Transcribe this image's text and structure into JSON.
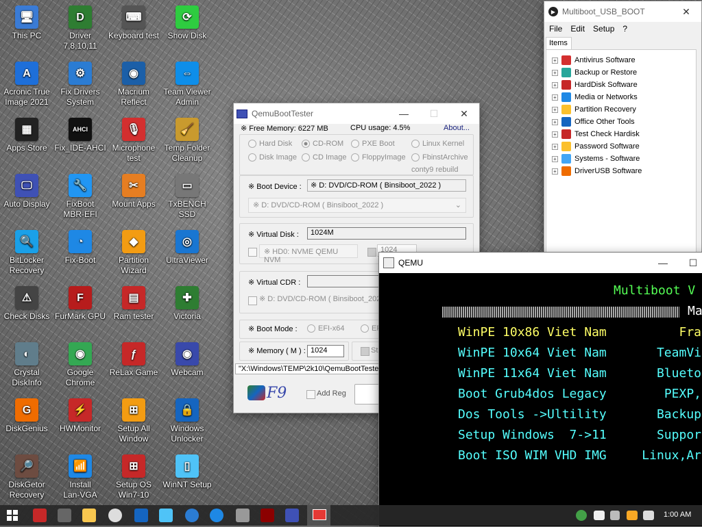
{
  "desktop": {
    "icons": [
      {
        "label": "This PC",
        "glyph": "🖥",
        "color": "#3a7bd5"
      },
      {
        "label": "Driver\n7,8,10,11",
        "glyph": "D",
        "color": "#2e7d32"
      },
      {
        "label": "Keyboard test",
        "glyph": "⌨",
        "color": "#555555"
      },
      {
        "label": "Show Disk",
        "glyph": "⟳",
        "color": "#2ecc40"
      },
      {
        "label": "Acronic True\nImage 2021",
        "glyph": "A",
        "color": "#1e6fd9"
      },
      {
        "label": "Fix Drivers\nSystem",
        "glyph": "⚙",
        "color": "#2b7cd3"
      },
      {
        "label": "Macrium\nReflect",
        "glyph": "◉",
        "color": "#1b5fa8"
      },
      {
        "label": "Team Viewer\nAdmin",
        "glyph": "⇔",
        "color": "#0e8ee9"
      },
      {
        "label": "Apps Store",
        "glyph": "▦",
        "color": "#222222"
      },
      {
        "label": "Fix_IDE-AHCI",
        "glyph": "AHCI",
        "color": "#111111"
      },
      {
        "label": "Microphone\ntest",
        "glyph": "🎙",
        "color": "#d32f2f"
      },
      {
        "label": "Temp Folder\nCleanup",
        "glyph": "🧹",
        "color": "#c99a2e"
      },
      {
        "label": "Auto Display",
        "glyph": "🖵",
        "color": "#3f51b5"
      },
      {
        "label": "FixBoot\nMBR-EFI",
        "glyph": "🔧",
        "color": "#2196f3"
      },
      {
        "label": "Mount Apps",
        "glyph": "✂",
        "color": "#e67e22"
      },
      {
        "label": "TxBENCH SSD",
        "glyph": "▭",
        "color": "#777777"
      },
      {
        "label": "BitLocker\nRecovery",
        "glyph": "🔍",
        "color": "#1aa0e8"
      },
      {
        "label": "Fix-Boot",
        "glyph": "◔",
        "color": "#1e88e5"
      },
      {
        "label": "Partition\nWizard",
        "glyph": "◆",
        "color": "#f39c12"
      },
      {
        "label": "UltraViewer",
        "glyph": "◎",
        "color": "#1976d2"
      },
      {
        "label": "Check Disks",
        "glyph": "⚠",
        "color": "#444444"
      },
      {
        "label": "FurMark GPU",
        "glyph": "F",
        "color": "#b71c1c"
      },
      {
        "label": "Ram tester",
        "glyph": "▤",
        "color": "#c62828"
      },
      {
        "label": "Victoria",
        "glyph": "✚",
        "color": "#2e7d32"
      },
      {
        "label": "Crystal\nDiskInfo",
        "glyph": "◐",
        "color": "#607d8b"
      },
      {
        "label": "Google\nChrome",
        "glyph": "◉",
        "color": "#34a853"
      },
      {
        "label": "ReLax Game",
        "glyph": "ƒ",
        "color": "#c62828"
      },
      {
        "label": "Webcam",
        "glyph": "◉",
        "color": "#3949ab"
      },
      {
        "label": "DiskGenius",
        "glyph": "G",
        "color": "#ef6c00"
      },
      {
        "label": "HWMonitor",
        "glyph": "⚡",
        "color": "#c62828"
      },
      {
        "label": "Setup All\nWindow",
        "glyph": "⊞",
        "color": "#f39c12"
      },
      {
        "label": "Windows\nUnlocker",
        "glyph": "🔒",
        "color": "#1565c0"
      },
      {
        "label": "DiskGetor\nRecovery",
        "glyph": "🔎",
        "color": "#6d4c41"
      },
      {
        "label": "Install\nLan-VGA",
        "glyph": "📶",
        "color": "#1e88e5"
      },
      {
        "label": "Setup OS\nWin7-10",
        "glyph": "⊞",
        "color": "#c62828"
      },
      {
        "label": "WinNT Setup",
        "glyph": "▯",
        "color": "#4fc3f7"
      }
    ]
  },
  "qemu_boot_tester": {
    "title": "QemuBootTester",
    "free_memory": "※ Free Memory: 6227 MB",
    "cpu_usage": "CPU usage: 4.5%",
    "about": "About...",
    "radios": [
      "Hard Disk",
      "CD-ROM",
      "PXE Boot",
      "Linux Kernel",
      "Disk Image",
      "CD Image",
      "FloppyImage",
      "FbinstArchive"
    ],
    "credit": "conty9 rebuild",
    "boot_device_label": "※ Boot Device :",
    "boot_device_value": "※ D: DVD/CD-ROM  ( Binsiboot_2022 )",
    "boot_device_combo": "※ D: DVD/CD-ROM  ( Binsiboot_2022 )",
    "virtual_disk_label": "※ Virtual Disk :",
    "virtual_disk_value": "1024M",
    "hd0_combo": "※ HD0: NVME QEMU NVM",
    "hd_extra_value": "1024",
    "virtual_cdr_label": "※ Virtual CDR :",
    "virtual_cdr_value": "",
    "cdr_combo": "※ D: DVD/CD-ROM  ( Binsiboot_202",
    "boot_mode_label": "※ Boot Mode :",
    "boot_mode_options": [
      "EFI-x64",
      "EF"
    ],
    "memory_label": "※ Memory ( M ) :",
    "memory_value": "1024",
    "memory_extra": "St",
    "path": "\"X:\\Windows\\TEMP\\2k10\\QemuBootTester",
    "f9_label": "F9",
    "add_reg_label": "Add Reg"
  },
  "multiboot": {
    "title": "Multiboot_USB_BOOT",
    "menu": [
      "File",
      "Edit",
      "Setup",
      "?"
    ],
    "tab": "Items",
    "items": [
      {
        "label": "Antivirus Software",
        "color": "#d32f2f"
      },
      {
        "label": "Backup or Restore",
        "color": "#26a69a"
      },
      {
        "label": "HardDisk Software",
        "color": "#c62828"
      },
      {
        "label": "Media or Networks",
        "color": "#1e88e5"
      },
      {
        "label": "Partition Recovery",
        "color": "#fbc02d"
      },
      {
        "label": "Office Other Tools",
        "color": "#1565c0"
      },
      {
        "label": "Test Check Hardisk",
        "color": "#c62828"
      },
      {
        "label": "Password Software",
        "color": "#fbc02d"
      },
      {
        "label": "Systems - Software",
        "color": "#42a5f5"
      },
      {
        "label": "DriverUSB Software",
        "color": "#ef6c00"
      }
    ]
  },
  "qemu": {
    "title": "QEMU",
    "heading": "Multiboot V",
    "hatch_text": "Ma",
    "rows": [
      {
        "left": "WinPE 10x86 Viet Nam",
        "right": "Fra",
        "color": "#ffff66"
      },
      {
        "left": "WinPE 10x64 Viet Nam",
        "right": "TeamVi",
        "color": "#55ffff"
      },
      {
        "left": "WinPE 11x64 Viet Nam",
        "right": "Blueto",
        "color": "#55ffff"
      },
      {
        "left": "Boot Grub4dos Legacy",
        "right": "PEXP,",
        "color": "#55ffff"
      },
      {
        "left": "Dos Tools ->Ultility",
        "right": "Backup",
        "color": "#55ffff"
      },
      {
        "left": "Setup Windows  7->11",
        "right": "Suppor",
        "color": "#55ffff"
      },
      {
        "left": "Boot ISO WIM VHD IMG",
        "right": "Linux,Ar",
        "color": "#55ffff"
      }
    ],
    "heading_color": "#55ff55"
  },
  "taskbar": {
    "clock": "1:00 AM"
  }
}
